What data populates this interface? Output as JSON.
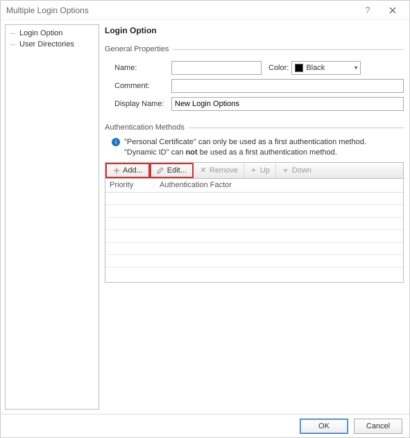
{
  "window": {
    "title": "Multiple Login Options"
  },
  "tree": {
    "items": [
      {
        "label": "Login Option"
      },
      {
        "label": "User Directories"
      }
    ]
  },
  "page": {
    "heading": "Login Option"
  },
  "general": {
    "section_label": "General Properties",
    "name_label": "Name:",
    "name_value": "",
    "color_label": "Color:",
    "color_value": "Black",
    "color_hex": "#000000",
    "comment_label": "Comment:",
    "comment_value": "",
    "display_label": "Display Name:",
    "display_value": "New Login Options"
  },
  "auth": {
    "section_label": "Authentication Methods",
    "note_line1": "\"Personal Certificate\" can only be used as a first authentication method.",
    "note_line2_pre": "\"Dynamic ID\" can ",
    "note_line2_bold": "not",
    "note_line2_post": " be used as a first authentication method.",
    "toolbar": {
      "add": "Add...",
      "edit": "Edit...",
      "remove": "Remove",
      "up": "Up",
      "down": "Down"
    },
    "columns": {
      "priority": "Priority",
      "factor": "Authentication Factor"
    }
  },
  "footer": {
    "ok": "OK",
    "cancel": "Cancel"
  }
}
